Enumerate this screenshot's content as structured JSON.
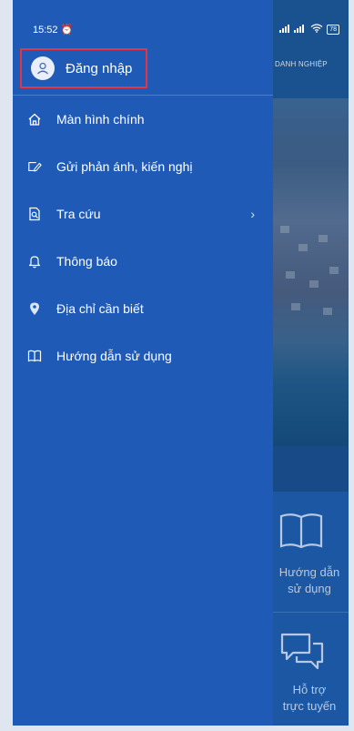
{
  "status_bar": {
    "time": "15:52",
    "battery": "78"
  },
  "background_app": {
    "header_text": "DANH NGHIỆP",
    "tiles": [
      {
        "label_line1": "Hướng dẫn",
        "label_line2": "sử dụng",
        "icon": "book-icon"
      },
      {
        "label_line1": "Hỗ trợ",
        "label_line2": "trực tuyến",
        "icon": "chat-icon"
      }
    ]
  },
  "drawer": {
    "login_label": "Đăng nhập",
    "items": [
      {
        "label": "Màn hình chính",
        "icon": "home-icon"
      },
      {
        "label": "Gửi phản ánh, kiến nghị",
        "icon": "feedback-icon"
      },
      {
        "label": "Tra cứu",
        "icon": "search-document-icon",
        "has_submenu": true
      },
      {
        "label": "Thông báo",
        "icon": "bell-icon"
      },
      {
        "label": "Địa chỉ cần biết",
        "icon": "location-pin-icon"
      },
      {
        "label": "Hướng dẫn sử dụng",
        "icon": "book-icon"
      }
    ]
  },
  "colors": {
    "drawer": "#1f5bb6",
    "highlight_border": "#e53545",
    "text": "#ffffff"
  }
}
